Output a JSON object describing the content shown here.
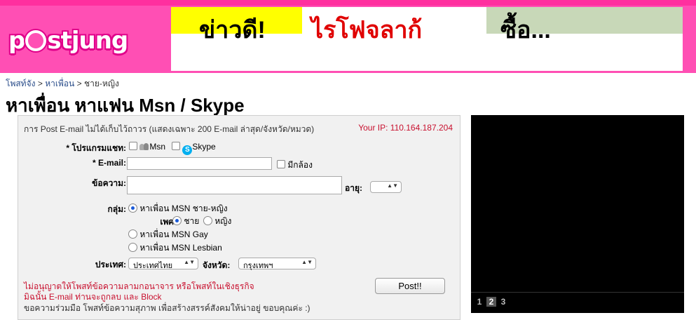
{
  "header": {
    "logo_prefix": "p",
    "logo_suffix": "stjung",
    "banner": [
      "ข่าวดี!",
      "ไรโฟจลาก้",
      "ซื้อ..."
    ]
  },
  "breadcrumb": {
    "items": [
      "โพสท์จัง",
      "หาเพื่อน",
      "ชาย-หญิง"
    ],
    "sep": ">"
  },
  "page_title": "หาเพื่อน หาแฟน Msn / Skype",
  "form": {
    "note": "การ Post E-mail ไม่ได้เก็บไว้ถาวร (แสดงเฉพาะ 200 E-mail ล่าสุด/จังหวัด/หมวด)",
    "ip": "Your IP: 110.164.187.204",
    "program_label": "* โปรแกรมแชท:",
    "msn_label": "Msn",
    "skype_label": "Skype",
    "email_label": "* E-mail:",
    "email_value": "",
    "camera_label": "มีกล้อง",
    "message_label": "ข้อความ:",
    "message_value": "",
    "age_label": "อายุ:",
    "age_value": "",
    "group_label": "กลุ่ม:",
    "groups": [
      "หาเพื่อน MSN ชาย-หญิง",
      "หาเพื่อน MSN Gay",
      "หาเพื่อน MSN Lesbian"
    ],
    "gender_label": "เพศ:",
    "genders": [
      "ชาย",
      "หญิง"
    ],
    "country_label": "ประเทศ:",
    "country_value": "ประเทศไทย",
    "province_label": "จังหวัด:",
    "province_value": "กรุงเทพฯ",
    "warning_1": "ไม่อนุญาตให้โพสท์ข้อความลามกอนาจาร หรือโพสท์ในเชิงธุรกิจ",
    "warning_2": "มิฉนั้น E-mail ท่านจะถูกลบ และ Block",
    "info": "ขอความร่วมมือ โพสท์ข้อความสุภาพ เพื่อสร้างสรรค์สังคมให้น่าอยู่ ขอบคุณค่ะ :)",
    "post_button": "Post!!"
  },
  "video": {
    "pages": [
      "1",
      "2",
      "3"
    ],
    "active_page": "2"
  }
}
